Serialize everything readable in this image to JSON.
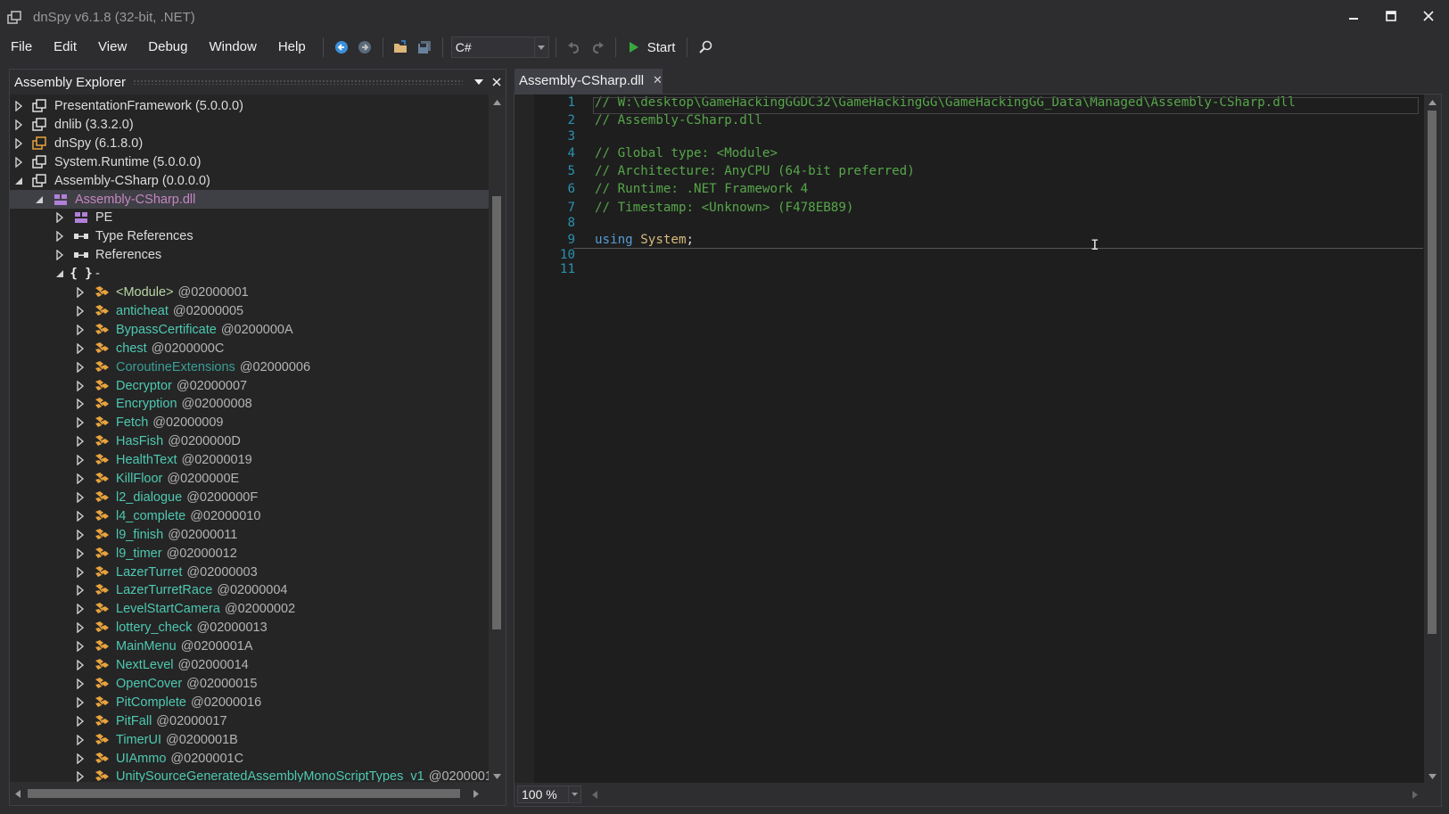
{
  "window": {
    "title": "dnSpy v6.1.8 (32-bit, .NET)",
    "controls": {
      "minimize": "minimize-icon",
      "maximize": "maximize-icon",
      "close": "close-icon"
    }
  },
  "menu": [
    "File",
    "Edit",
    "View",
    "Debug",
    "Window",
    "Help"
  ],
  "toolbar": {
    "language": "C#",
    "start_label": "Start"
  },
  "explorer": {
    "title": "Assembly Explorer",
    "nodes": [
      {
        "indent": 0,
        "expander": "collapsed",
        "icon": "assembly-icon",
        "name": "PresentationFramework (5.0.0.0)",
        "token": "",
        "style": "t-white"
      },
      {
        "indent": 0,
        "expander": "collapsed",
        "icon": "assembly-icon",
        "name": "dnlib (3.3.2.0)",
        "token": "",
        "style": "t-white"
      },
      {
        "indent": 0,
        "expander": "collapsed",
        "icon": "assembly-orange-icon",
        "name": "dnSpy (6.1.8.0)",
        "token": "",
        "style": "t-white"
      },
      {
        "indent": 0,
        "expander": "collapsed",
        "icon": "assembly-icon",
        "name": "System.Runtime (5.0.0.0)",
        "token": "",
        "style": "t-white"
      },
      {
        "indent": 0,
        "expander": "expanded",
        "icon": "assembly-icon",
        "name": "Assembly-CSharp (0.0.0.0)",
        "token": "",
        "style": "t-white"
      },
      {
        "indent": 1,
        "expander": "expanded",
        "icon": "module-icon",
        "name": "Assembly-CSharp.dll",
        "token": "",
        "style": "t-purple",
        "selected": true
      },
      {
        "indent": 2,
        "expander": "collapsed",
        "icon": "pe-icon",
        "name": "PE",
        "token": "",
        "style": "t-white"
      },
      {
        "indent": 2,
        "expander": "collapsed",
        "icon": "references-icon",
        "name": "Type References",
        "token": "",
        "style": "t-white"
      },
      {
        "indent": 2,
        "expander": "collapsed",
        "icon": "references-icon",
        "name": "References",
        "token": "",
        "style": "t-white"
      },
      {
        "indent": 2,
        "expander": "expanded",
        "icon": "namespace-icon",
        "name": "-",
        "token": "",
        "style": "t-white"
      },
      {
        "indent": 3,
        "expander": "collapsed",
        "icon": "class-icon",
        "name": "<Module>",
        "token": "@02000001",
        "style": "t-module"
      },
      {
        "indent": 3,
        "expander": "collapsed",
        "icon": "class-icon",
        "name": "anticheat",
        "token": "@02000005",
        "style": "t-type"
      },
      {
        "indent": 3,
        "expander": "collapsed",
        "icon": "class-icon",
        "name": "BypassCertificate",
        "token": "@0200000A",
        "style": "t-type"
      },
      {
        "indent": 3,
        "expander": "collapsed",
        "icon": "class-icon",
        "name": "chest",
        "token": "@0200000C",
        "style": "t-type"
      },
      {
        "indent": 3,
        "expander": "collapsed",
        "icon": "class-icon",
        "name": "CoroutineExtensions",
        "token": "@02000006",
        "style": "t-static"
      },
      {
        "indent": 3,
        "expander": "collapsed",
        "icon": "class-icon",
        "name": "Decryptor",
        "token": "@02000007",
        "style": "t-type"
      },
      {
        "indent": 3,
        "expander": "collapsed",
        "icon": "class-icon",
        "name": "Encryption",
        "token": "@02000008",
        "style": "t-type"
      },
      {
        "indent": 3,
        "expander": "collapsed",
        "icon": "class-icon",
        "name": "Fetch",
        "token": "@02000009",
        "style": "t-type"
      },
      {
        "indent": 3,
        "expander": "collapsed",
        "icon": "class-icon",
        "name": "HasFish",
        "token": "@0200000D",
        "style": "t-type"
      },
      {
        "indent": 3,
        "expander": "collapsed",
        "icon": "class-icon",
        "name": "HealthText",
        "token": "@02000019",
        "style": "t-type"
      },
      {
        "indent": 3,
        "expander": "collapsed",
        "icon": "class-icon",
        "name": "KillFloor",
        "token": "@0200000E",
        "style": "t-type"
      },
      {
        "indent": 3,
        "expander": "collapsed",
        "icon": "class-icon",
        "name": "l2_dialogue",
        "token": "@0200000F",
        "style": "t-type"
      },
      {
        "indent": 3,
        "expander": "collapsed",
        "icon": "class-icon",
        "name": "l4_complete",
        "token": "@02000010",
        "style": "t-type"
      },
      {
        "indent": 3,
        "expander": "collapsed",
        "icon": "class-icon",
        "name": "l9_finish",
        "token": "@02000011",
        "style": "t-type"
      },
      {
        "indent": 3,
        "expander": "collapsed",
        "icon": "class-icon",
        "name": "l9_timer",
        "token": "@02000012",
        "style": "t-type"
      },
      {
        "indent": 3,
        "expander": "collapsed",
        "icon": "class-icon",
        "name": "LazerTurret",
        "token": "@02000003",
        "style": "t-type"
      },
      {
        "indent": 3,
        "expander": "collapsed",
        "icon": "class-icon",
        "name": "LazerTurretRace",
        "token": "@02000004",
        "style": "t-type"
      },
      {
        "indent": 3,
        "expander": "collapsed",
        "icon": "class-icon",
        "name": "LevelStartCamera",
        "token": "@02000002",
        "style": "t-type"
      },
      {
        "indent": 3,
        "expander": "collapsed",
        "icon": "class-icon",
        "name": "lottery_check",
        "token": "@02000013",
        "style": "t-type"
      },
      {
        "indent": 3,
        "expander": "collapsed",
        "icon": "class-icon",
        "name": "MainMenu",
        "token": "@0200001A",
        "style": "t-type"
      },
      {
        "indent": 3,
        "expander": "collapsed",
        "icon": "class-icon",
        "name": "NextLevel",
        "token": "@02000014",
        "style": "t-type"
      },
      {
        "indent": 3,
        "expander": "collapsed",
        "icon": "class-icon",
        "name": "OpenCover",
        "token": "@02000015",
        "style": "t-type"
      },
      {
        "indent": 3,
        "expander": "collapsed",
        "icon": "class-icon",
        "name": "PitComplete",
        "token": "@02000016",
        "style": "t-type"
      },
      {
        "indent": 3,
        "expander": "collapsed",
        "icon": "class-icon",
        "name": "PitFall",
        "token": "@02000017",
        "style": "t-type"
      },
      {
        "indent": 3,
        "expander": "collapsed",
        "icon": "class-icon",
        "name": "TimerUI",
        "token": "@0200001B",
        "style": "t-type"
      },
      {
        "indent": 3,
        "expander": "collapsed",
        "icon": "class-icon",
        "name": "UIAmmo",
        "token": "@0200001C",
        "style": "t-type"
      },
      {
        "indent": 3,
        "expander": "collapsed",
        "icon": "class-icon",
        "name": "UnitySourceGeneratedAssemblyMonoScriptTypes_v1",
        "token": "@0200001",
        "style": "t-type"
      }
    ]
  },
  "editor": {
    "tab_label": "Assembly-CSharp.dll",
    "zoom": "100 %",
    "lines": [
      {
        "num": "1",
        "parts": [
          {
            "t": "// W:\\desktop\\GameHackingGGDC32\\GameHackingGG\\GameHackingGG_Data\\Managed\\Assembly-CSharp.dll",
            "c": "c-comment"
          }
        ]
      },
      {
        "num": "2",
        "parts": [
          {
            "t": "// Assembly-CSharp.dll",
            "c": "c-comment"
          }
        ]
      },
      {
        "num": "3",
        "parts": []
      },
      {
        "num": "4",
        "parts": [
          {
            "t": "// Global type: <Module>",
            "c": "c-comment"
          }
        ]
      },
      {
        "num": "5",
        "parts": [
          {
            "t": "// Architecture: AnyCPU (64-bit preferred)",
            "c": "c-comment"
          }
        ]
      },
      {
        "num": "6",
        "parts": [
          {
            "t": "// Runtime: .NET Framework 4",
            "c": "c-comment"
          }
        ]
      },
      {
        "num": "7",
        "parts": [
          {
            "t": "// Timestamp: <Unknown> (F478EB89)",
            "c": "c-comment"
          }
        ]
      },
      {
        "num": "8",
        "parts": []
      },
      {
        "num": "9",
        "parts": [
          {
            "t": "using",
            "c": "c-kw"
          },
          {
            "t": " ",
            "c": "c-plain"
          },
          {
            "t": "System",
            "c": "c-ns"
          },
          {
            "t": ";",
            "c": "c-plain"
          }
        ]
      },
      {
        "num": "10",
        "parts": []
      },
      {
        "num": "11",
        "parts": []
      }
    ]
  },
  "colors": {
    "background": "#2d2d30",
    "editor_bg": "#1e1e1e",
    "comment": "#57a64a",
    "keyword": "#569cd6",
    "type": "#4ec9b0",
    "line_number": "#2b91af",
    "selected_module": "#c586c0"
  }
}
